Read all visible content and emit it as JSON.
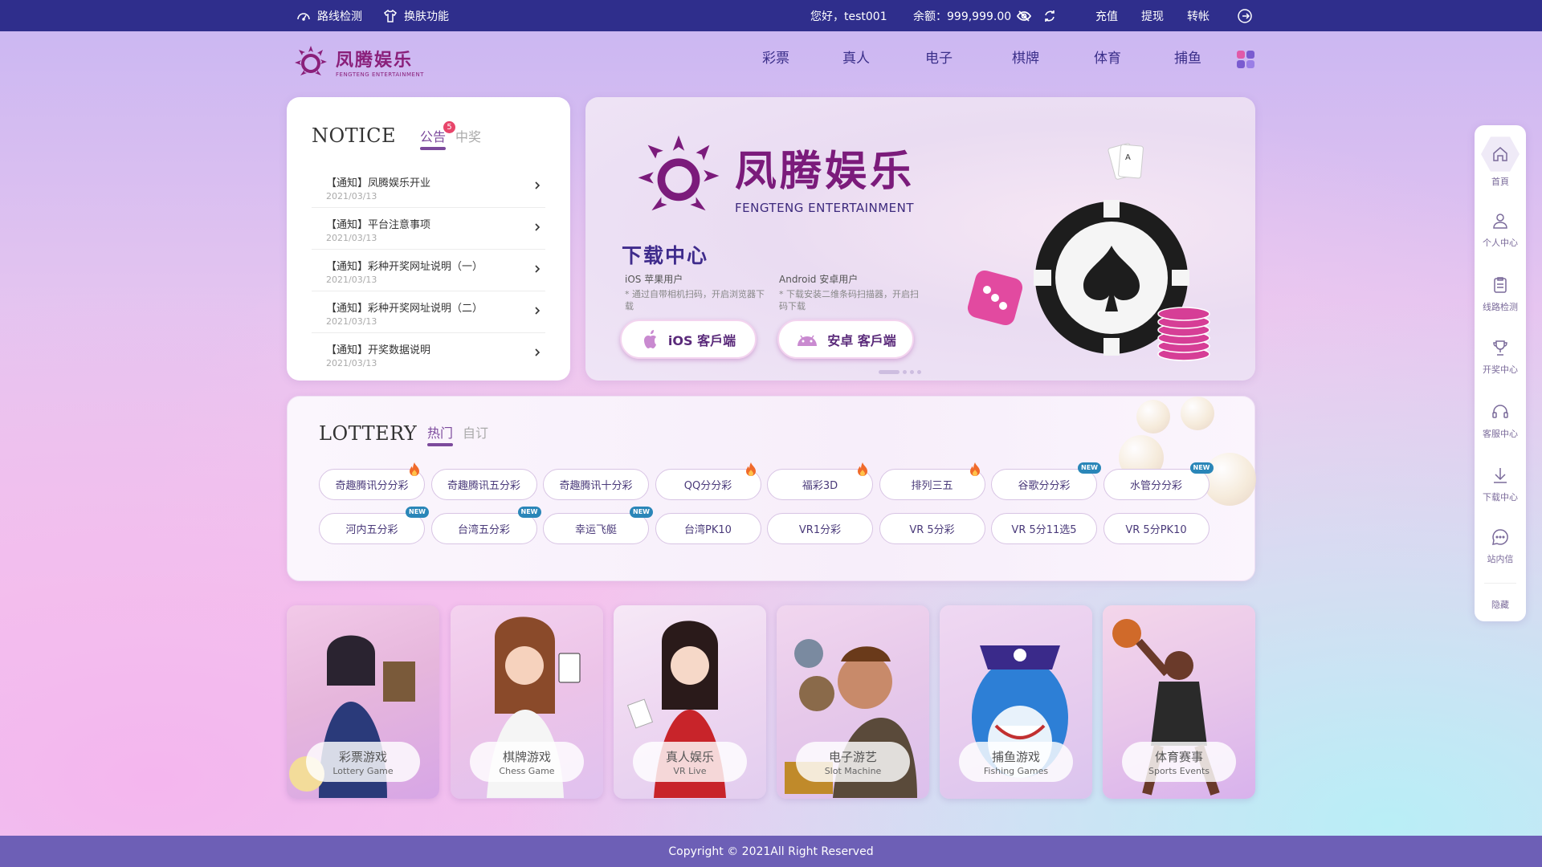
{
  "topbar": {
    "route_check": "路线检测",
    "skin_switch": "换肤功能",
    "greeting": "您好，test001",
    "balance": "余额：999,999.00",
    "recharge": "充值",
    "withdraw": "提现",
    "transfer": "转帐"
  },
  "header": {
    "logo_cn": "凤腾娱乐",
    "logo_en": "FENGTENG ENTERTAINMENT",
    "nav": [
      "彩票",
      "真人",
      "电子",
      "棋牌",
      "体育",
      "捕鱼"
    ]
  },
  "notice": {
    "title": "NOTICE",
    "tabs": [
      "公告",
      "中奖"
    ],
    "badge_count": "5",
    "items": [
      {
        "title": "【通知】凤腾娱乐开业",
        "date": "2021/03/13"
      },
      {
        "title": "【通知】平台注意事项",
        "date": "2021/03/13"
      },
      {
        "title": "【通知】彩种开奖网址说明（一）",
        "date": "2021/03/13"
      },
      {
        "title": "【通知】彩种开奖网址说明（二）",
        "date": "2021/03/13"
      },
      {
        "title": "【通知】开奖数据说明",
        "date": "2021/03/13"
      }
    ]
  },
  "banner": {
    "brand_cn": "凤腾娱乐",
    "brand_en": "FENGTENG ENTERTAINMENT",
    "download_title": "下载中心",
    "ios_heading": "iOS 苹果用户",
    "ios_note": "* 通过自带相机扫码，开启浏览器下载",
    "android_heading": "Android 安卓用户",
    "android_note": "* 下载安装二维条码扫描器，开启扫码下载",
    "ios_button": "iOS 客戶端",
    "android_button": "安卓 客戶端"
  },
  "lottery": {
    "title": "LOTTERY",
    "tabs": [
      "热门",
      "自订"
    ],
    "games": [
      {
        "name": "奇趣腾讯分分彩",
        "tag": "hot"
      },
      {
        "name": "奇趣腾讯五分彩",
        "tag": ""
      },
      {
        "name": "奇趣腾讯十分彩",
        "tag": ""
      },
      {
        "name": "QQ分分彩",
        "tag": "hot"
      },
      {
        "name": "福彩3D",
        "tag": "hot"
      },
      {
        "name": "排列三五",
        "tag": "hot"
      },
      {
        "name": "谷歌分分彩",
        "tag": "new"
      },
      {
        "name": "水管分分彩",
        "tag": "new"
      },
      {
        "name": "河内五分彩",
        "tag": "new"
      },
      {
        "name": "台湾五分彩",
        "tag": "new"
      },
      {
        "name": "幸运飞艇",
        "tag": "new"
      },
      {
        "name": "台湾PK10",
        "tag": ""
      },
      {
        "name": "VR1分彩",
        "tag": ""
      },
      {
        "name": "VR 5分彩",
        "tag": ""
      },
      {
        "name": "VR 5分11选5",
        "tag": ""
      },
      {
        "name": "VR 5分PK10",
        "tag": ""
      }
    ],
    "new_label": "NEW"
  },
  "categories": [
    {
      "cn": "彩票游戏",
      "en": "Lottery Game"
    },
    {
      "cn": "棋牌游戏",
      "en": "Chess Game"
    },
    {
      "cn": "真人娱乐",
      "en": "VR Live"
    },
    {
      "cn": "电子游艺",
      "en": "Slot Machine"
    },
    {
      "cn": "捕鱼游戏",
      "en": "Fishing Games"
    },
    {
      "cn": "体育赛事",
      "en": "Sports Events"
    }
  ],
  "sidebar": {
    "items": [
      "首頁",
      "个人中心",
      "线路检测",
      "开奖中心",
      "客服中心",
      "下载中心",
      "站内信"
    ],
    "hide": "隐藏"
  },
  "footer": {
    "copyright": "Copyright © 2021All Right Reserved"
  },
  "colors": {
    "topbar": "#2f2e8c",
    "accent": "#7c4a9c",
    "footer": "#6d5fb6",
    "new_badge": "#2a86b8",
    "hot_flame": "#f06a2a"
  }
}
